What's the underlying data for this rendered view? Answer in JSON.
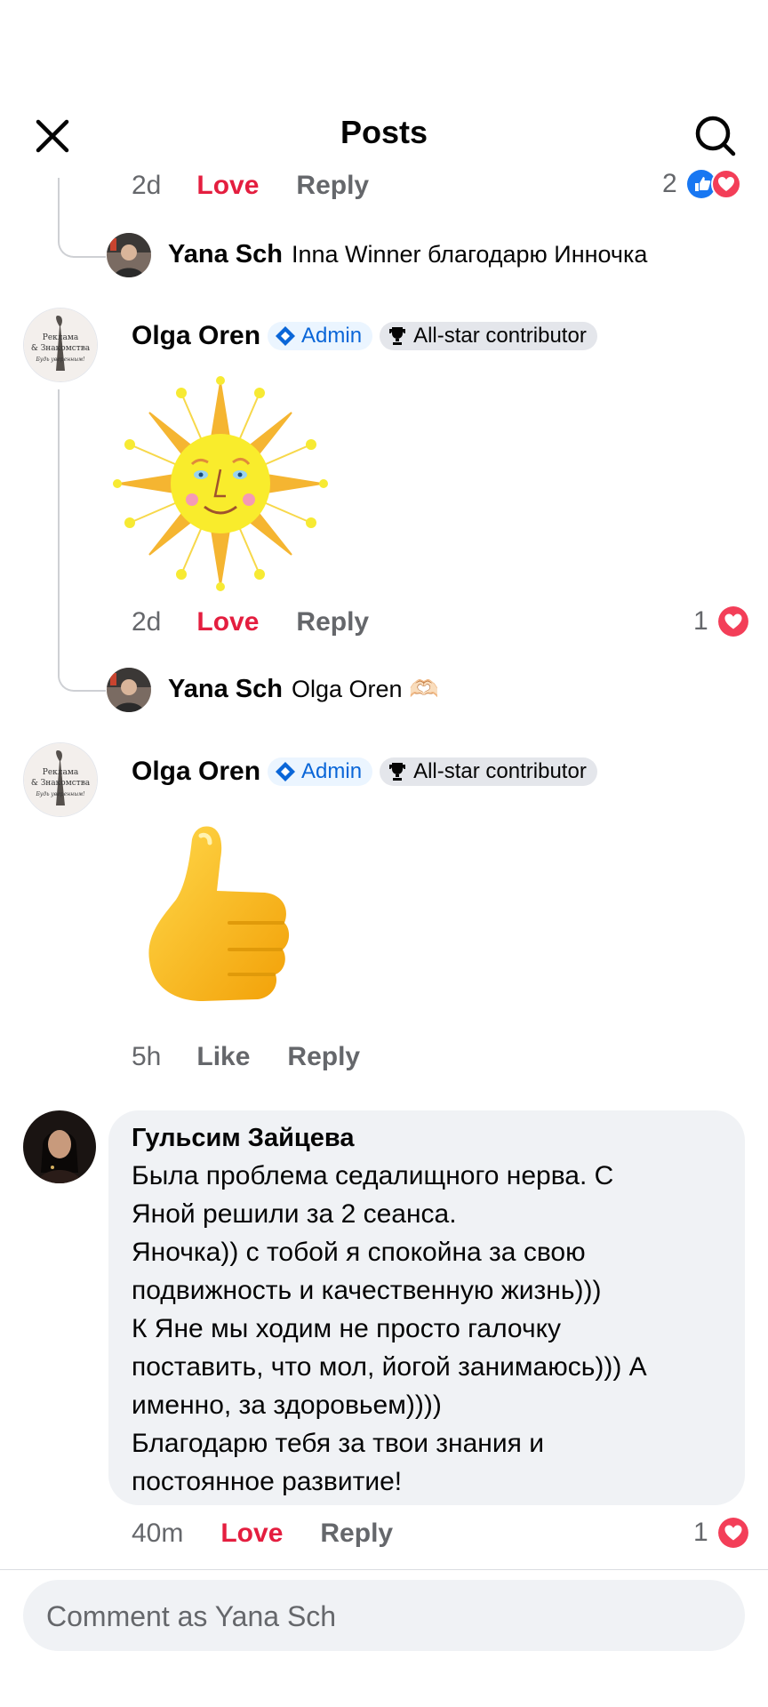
{
  "header": {
    "title": "Posts"
  },
  "comments": [
    {
      "meta": {
        "time": "2d",
        "react_label": "Love",
        "reply_label": "Reply",
        "reaction_count": "2"
      }
    },
    {
      "reply": {
        "name": "Yana Sch",
        "text": "Inna Winner благодарю Инночка"
      }
    },
    {
      "author": "Olga Oren",
      "badges": {
        "admin": "Admin",
        "allstar": "All-star contributor"
      },
      "sticker": "sun-sticker",
      "meta": {
        "time": "2d",
        "react_label": "Love",
        "reply_label": "Reply",
        "reaction_count": "1"
      },
      "avatar_text": [
        "Реклама",
        "& Знакомства",
        "Будь уверенным!"
      ]
    },
    {
      "reply": {
        "name": "Yana Sch",
        "text": "Olga Oren 🫶🏻"
      }
    },
    {
      "author": "Olga Oren",
      "badges": {
        "admin": "Admin",
        "allstar": "All-star contributor"
      },
      "sticker": "thumbs-up-sticker",
      "meta": {
        "time": "5h",
        "react_label": "Like",
        "reply_label": "Reply"
      },
      "avatar_text": [
        "Реклама",
        "& Знакомства",
        "Будь уверенным!"
      ]
    },
    {
      "author": "Гульсим Зайцева",
      "lines": [
        "Была проблема седалищного нерва. С",
        "Яной решили за 2 сеанса.",
        "Яночка)) с тобой я спокойна за свою",
        "подвижность и качественную жизнь)))",
        "К Яне мы ходим не просто галочку",
        "поставить, что мол, йогой занимаюсь))) А",
        "именно, за здоровьем))))",
        "Благодарю тебя за твои знания и",
        "постоянное развитие!"
      ],
      "meta": {
        "time": "40m",
        "react_label": "Love",
        "reply_label": "Reply",
        "reaction_count": "1"
      }
    }
  ],
  "composer": {
    "placeholder": "Comment as Yana Sch"
  },
  "colors": {
    "love": "#e41e3f",
    "like": "#1877f2",
    "admin": "#0a66d8",
    "muted": "#65676b"
  },
  "icons": [
    "close-icon",
    "search-icon",
    "like-reaction-icon",
    "love-reaction-icon",
    "admin-diamond-icon",
    "trophy-icon"
  ]
}
